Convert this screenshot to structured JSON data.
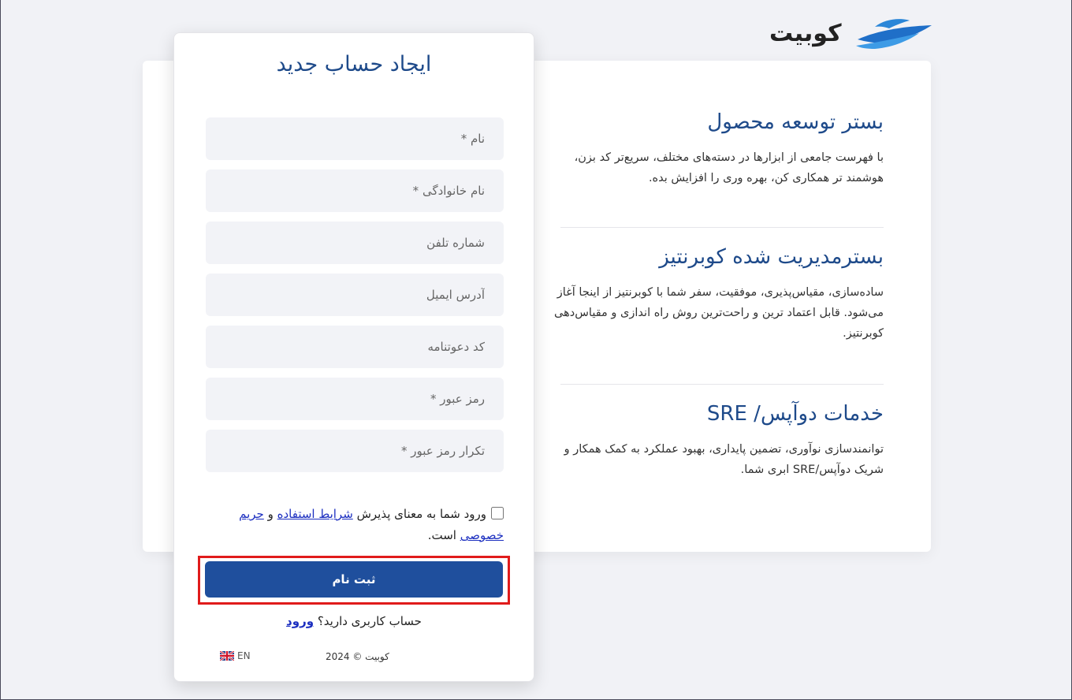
{
  "brand": {
    "name": "کوبیت"
  },
  "info": {
    "sections": [
      {
        "title": "بستر توسعه محصول",
        "desc": "با فهرست جامعی از ابزارها در دسته‌های مختلف، سریع‌تر کد بزن، هوشمند تر همکاری کن، بهره وری را افزایش بده."
      },
      {
        "title": "بسترمدیریت شده کوبرنتیز",
        "desc": "ساده‌سازی، مقیاس‌پذیری، موفقیت، سفر شما با کوبرنتیز از اینجا آغاز می‌شود. قابل اعتماد ترین و راحت‌ترین روش راه اندازی و مقیاس‌دهی کوبرنتیز."
      },
      {
        "title": "خدمات دوآپس/ SRE",
        "desc": "توانمندسازی نوآوری، تضمین پایداری، بهبود عملکرد به کمک همکار و شریک دوآپس/SRE ابری شما."
      }
    ]
  },
  "form": {
    "title": "ایجاد حساب جدید",
    "fields": {
      "first_name": "نام *",
      "last_name": "نام خانوادگی *",
      "phone": "شماره تلفن",
      "email": "آدرس ایمیل",
      "invite_code": "کد دعوتنامه",
      "password": "رمز عبور *",
      "password_repeat": "تکرار رمز عبور *"
    },
    "terms": {
      "prefix": "ورود شما به معنای پذیرش",
      "terms_link": "شرایط استفاده",
      "and": "و",
      "privacy_link": "حریم خصوصی",
      "suffix": "است."
    },
    "submit_label": "ثبت نام",
    "have_account": "حساب کاربری دارید؟",
    "login_link": "ورود"
  },
  "footer": {
    "copyright": "کوبیت © 2024",
    "language": "EN"
  }
}
